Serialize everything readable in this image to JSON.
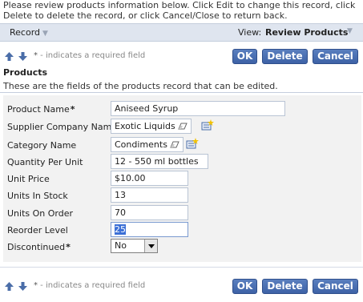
{
  "intro_text": "Please review products information below. Click Edit to change this record, click Delete to delete the record, or click Cancel/Close to return back.",
  "viewbar": {
    "record_label": "Record",
    "view_label": "View:",
    "view_value": "Review Products"
  },
  "toolbar": {
    "required_star": "*",
    "required_note": " - indicates a required field",
    "ok_label": "OK",
    "delete_label": "Delete",
    "cancel_label": "Cancel"
  },
  "section": {
    "title": "Products",
    "description": "These are the fields of the products record that can be edited."
  },
  "fields": {
    "product_name": {
      "label": "Product Name",
      "star": "*",
      "value": "Aniseed Syrup"
    },
    "supplier": {
      "label": "Supplier Company Name",
      "value": "Exotic Liquids"
    },
    "category": {
      "label": "Category Name",
      "value": "Condiments"
    },
    "quantity": {
      "label": "Quantity Per Unit",
      "value": "12 - 550 ml bottles"
    },
    "unit_price": {
      "label": "Unit Price",
      "value": "$10.00"
    },
    "units_in_stock": {
      "label": "Units In Stock",
      "value": "13"
    },
    "units_on_order": {
      "label": "Units On Order",
      "value": "70"
    },
    "reorder_level": {
      "label": "Reorder Level",
      "value": "25"
    },
    "discontinued": {
      "label": "Discontinued",
      "star": "*",
      "value": "No"
    }
  },
  "colors": {
    "button": "#3d62a6",
    "bar": "#dfe5ef",
    "panel": "#f2f2f2"
  }
}
